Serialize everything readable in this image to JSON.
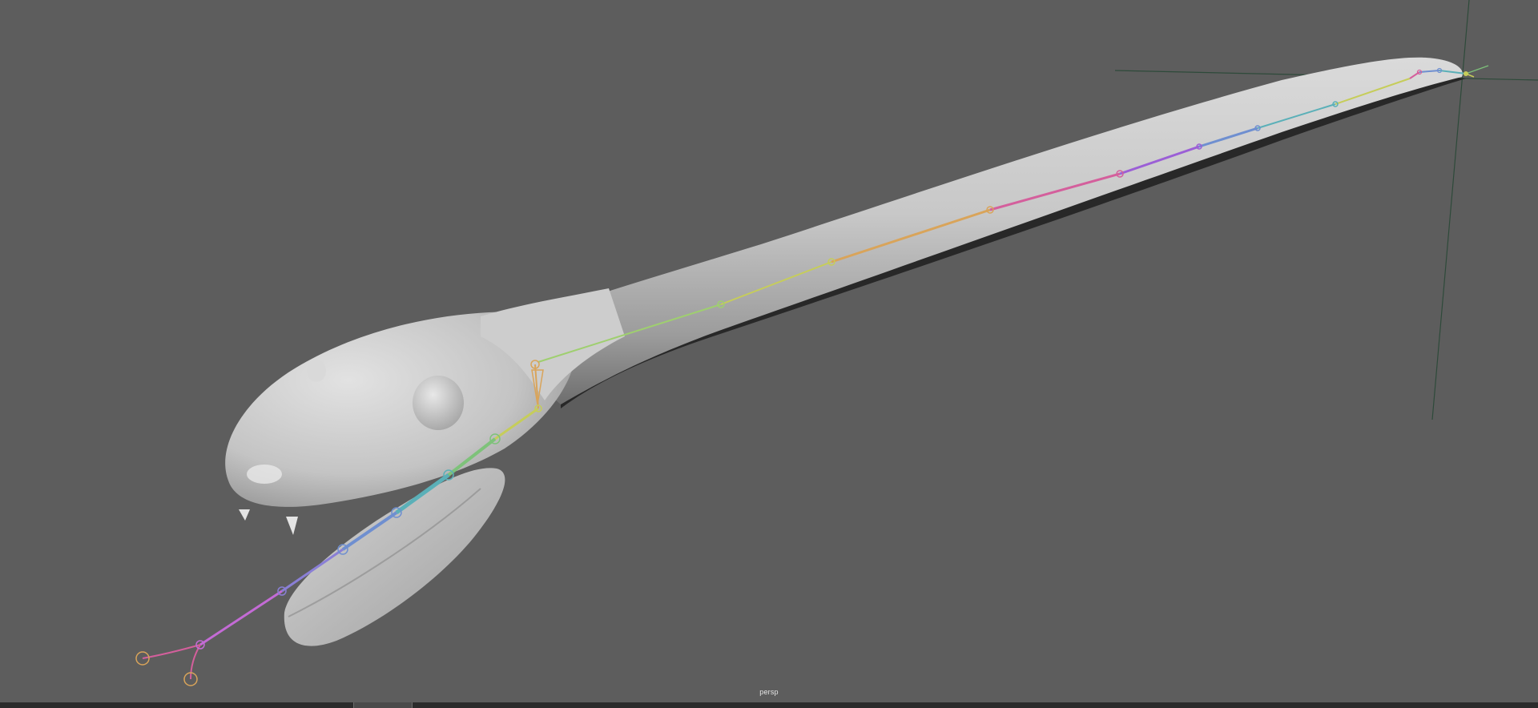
{
  "viewport": {
    "camera_label": "persp",
    "background_color": "#5d5d5d"
  },
  "scene": {
    "object": "snake-mesh",
    "mesh_color": "#c9c9c9",
    "skeleton_joint_colors": [
      "#c46bd6",
      "#6f8fd0",
      "#5bb0b8",
      "#7ec27a",
      "#c6cd5a",
      "#d9a45a",
      "#d45f9c",
      "#9b5fd6"
    ]
  },
  "timeline": {
    "background_color": "#2b2b2b"
  }
}
